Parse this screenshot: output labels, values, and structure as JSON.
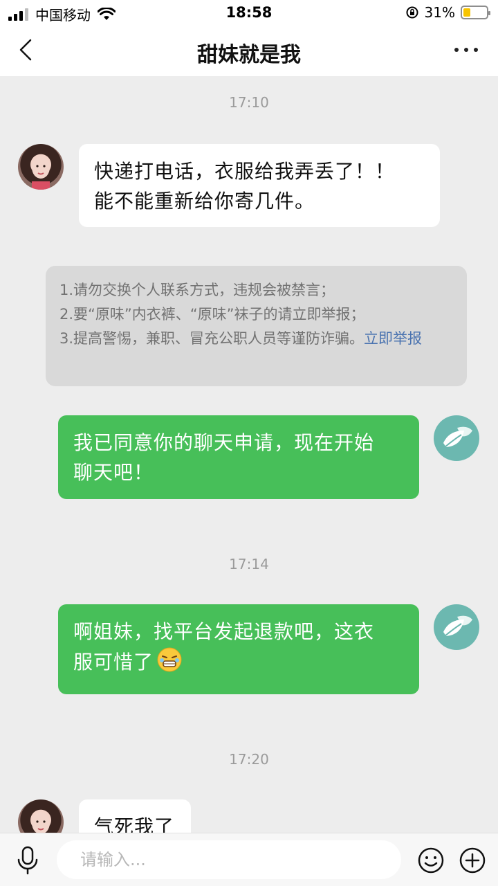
{
  "status_bar": {
    "carrier": "中国移动",
    "time": "18:58",
    "battery": "31%",
    "battery_level": 0.31,
    "icons": [
      "signal-icon",
      "wifi-icon",
      "rotation-lock-icon",
      "battery-icon"
    ]
  },
  "header": {
    "title": "甜妹就是我",
    "icons": [
      "back-arrow-icon",
      "more-dots-icon"
    ]
  },
  "messages": [
    {
      "type": "time",
      "text": "17:10"
    },
    {
      "type": "incoming",
      "avatar": "girl-avatar",
      "lines": [
        "快递打电话，衣服给我弄丢了！！",
        "能不能重新给你寄几件。"
      ]
    },
    {
      "type": "notice",
      "lines": [
        "1.请勿交换个人联系方式，违规会被禁言；",
        "2.要“原味”内衣裤、“原味”袜子的请立即举报；",
        "3.提高警惕，兼职、冒充公职人员等谨防诈骗。"
      ],
      "link": "立即举报"
    },
    {
      "type": "outgoing",
      "avatar": "leaf-avatar",
      "lines": [
        "我已同意你的聊天申请，现在开始",
        "聊天吧！"
      ]
    },
    {
      "type": "time",
      "text": "17:14"
    },
    {
      "type": "outgoing",
      "avatar": "leaf-avatar",
      "lines": [
        "啊姐妹，找平台发起退款吧，这衣",
        "服可惜了"
      ],
      "emoji": "grimace-laugh-emoji"
    },
    {
      "type": "time",
      "text": "17:20"
    },
    {
      "type": "incoming",
      "avatar": "girl-avatar",
      "lines": [
        "气死我了"
      ]
    }
  ],
  "input_bar": {
    "placeholder": "请输入...",
    "icons": [
      "microphone-icon",
      "emoji-icon",
      "plus-icon"
    ]
  },
  "colors": {
    "outgoing_bubble": "#47bf59",
    "incoming_bubble": "#ffffff",
    "background": "#ededed",
    "link": "#4a73b0"
  }
}
